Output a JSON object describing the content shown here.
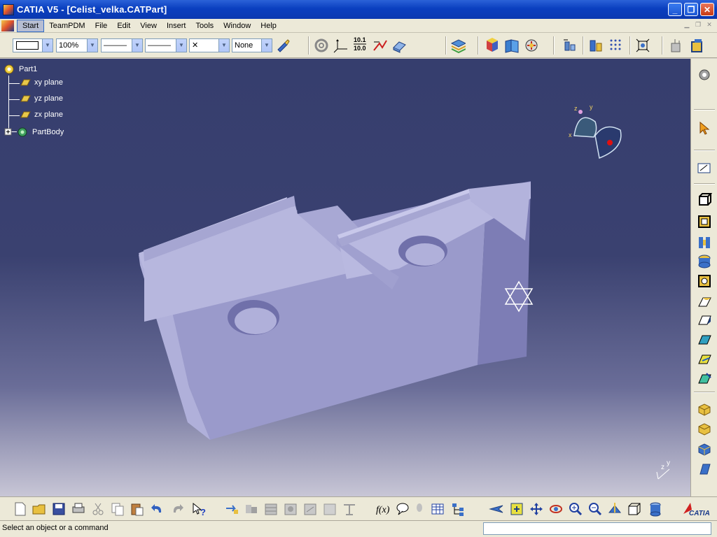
{
  "window": {
    "title": "CATIA V5 - [Celist_velka.CATPart]",
    "minimize_glyph": "_",
    "restore_glyph": "❐",
    "close_glyph": "✕"
  },
  "menu": {
    "items": [
      "Start",
      "TeamPDM",
      "File",
      "Edit",
      "View",
      "Insert",
      "Tools",
      "Window",
      "Help"
    ],
    "active": "Start"
  },
  "toolbar_top": {
    "line_color": "",
    "zoom": "100%",
    "line_type": "———",
    "line_weight": "———",
    "point_type": "✕",
    "layer": "None"
  },
  "tree": {
    "root": "Part1",
    "children": [
      "xy plane",
      "yz plane",
      "zx plane",
      "PartBody"
    ]
  },
  "status": {
    "message": "Select an object or a command",
    "command_value": ""
  },
  "compass_axes": {
    "x": "x",
    "y": "y",
    "z": "z"
  },
  "colors": {
    "titlebar": "#0a3fc0",
    "viewport_top": "#363e6e",
    "viewport_bottom": "#c8c6d6",
    "part_light": "#b9b9e0",
    "part_mid": "#9e9ece",
    "part_dark": "#8f8fc2",
    "plane_icon": "#e8c84a"
  },
  "icons": {
    "toolbar_top": [
      "fill-brush-icon",
      "swept-icon",
      "axis-system-icon",
      "measure-icon",
      "snap-icon",
      "surface-icon",
      "layer-stack-icon",
      "apply-material-icon",
      "catalog-icon",
      "render-icon",
      "sketcher-analysis-icon",
      "knowledge-icon",
      "grid-icon",
      "fit-all-icon",
      "hide-show-icon",
      "swap-icon"
    ],
    "toolbar_right": [
      "rotate-gear-icon",
      "select-arrow-icon",
      "sketch-icon",
      "pad-icon",
      "pocket-icon",
      "shaft-icon",
      "hole-icon",
      "rib-icon",
      "fillet-icon",
      "chamfer-icon",
      "draft-icon",
      "shell-icon",
      "thickness-icon",
      "thread-icon",
      "remove-face-icon",
      "split-icon",
      "thick-surface-icon",
      "close-surface-icon",
      "sew-surface-icon"
    ],
    "toolbar_bottom": [
      "new-icon",
      "open-icon",
      "save-icon",
      "print-icon",
      "cut-icon",
      "copy-icon",
      "paste-icon",
      "undo-icon",
      "redo-icon",
      "whats-this-icon",
      "update-icon",
      "formula-icon",
      "comment-icon",
      "table-icon",
      "tree-icon",
      "fly-mode-icon",
      "fit-all-bottom-icon",
      "pan-icon",
      "rotate-icon",
      "zoom-in-icon",
      "zoom-out-icon",
      "normal-view-icon",
      "views-icon",
      "render-style-icon",
      "catia-logo-icon"
    ]
  }
}
